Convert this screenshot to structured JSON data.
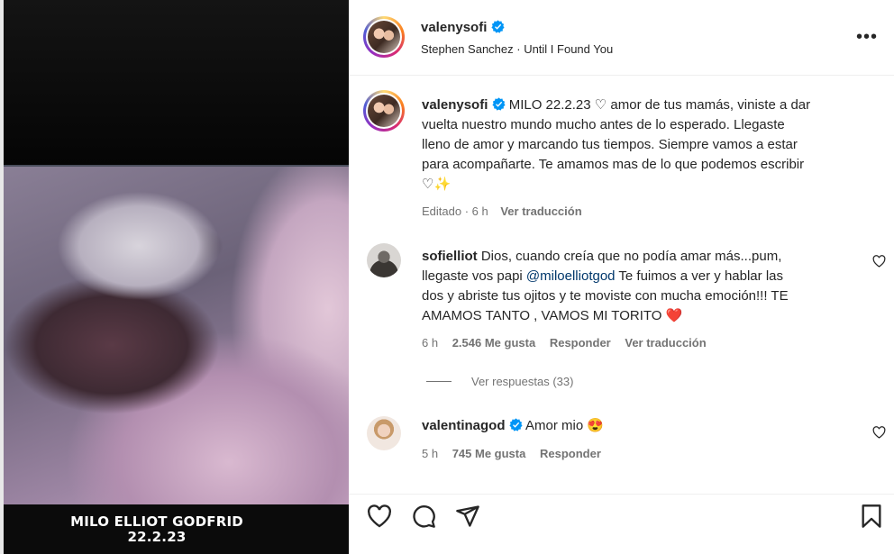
{
  "media": {
    "caption_line1": "MILO ELLIOT GODFRID",
    "caption_line2": "22.2.23"
  },
  "header": {
    "username": "valenysofi",
    "audio": "Stephen Sanchez · Until I Found You",
    "more_icon": "more-horizontal-icon"
  },
  "post_caption": {
    "username": "valenysofi",
    "line1": "MILO 22.2.23 ♡ amor de tus mamás, viniste a dar",
    "line2": "vuelta nuestro mundo mucho antes de lo esperado. Llegaste",
    "line3": "lleno de amor y marcando tus tiempos. Siempre vamos a estar",
    "line4": "para acompañarte. Te amamos mas de lo que podemos escribir",
    "line5": "♡✨",
    "edited": "Editado · 6 h",
    "translate": "Ver traducción"
  },
  "comments": [
    {
      "username": "sofielliot",
      "line1": "Dios, cuando creía que no podía amar más...pum,",
      "line2_pre": "llegaste vos papi ",
      "mention": "@miloelliotgod",
      "line2_post": " Te fuimos a ver y hablar las",
      "line3": "dos y abriste tus ojitos y te moviste con mucha emoción!!! TE",
      "line4": "AMAMOS TANTO , VAMOS MI TORITO ❤️",
      "time": "6 h",
      "likes": "2.546 Me gusta",
      "reply": "Responder",
      "translate": "Ver traducción",
      "view_replies": "Ver respuestas (33)"
    },
    {
      "username": "valentinagod",
      "text": "Amor mio 😍",
      "time": "5 h",
      "likes": "745 Me gusta",
      "reply": "Responder"
    }
  ],
  "actions": {
    "like_icon": "heart-icon",
    "comment_icon": "comment-icon",
    "share_icon": "send-icon",
    "save_icon": "bookmark-icon"
  },
  "colors": {
    "verified": "#0095f6",
    "text": "#262626",
    "meta": "#737373",
    "link": "#00376b"
  }
}
